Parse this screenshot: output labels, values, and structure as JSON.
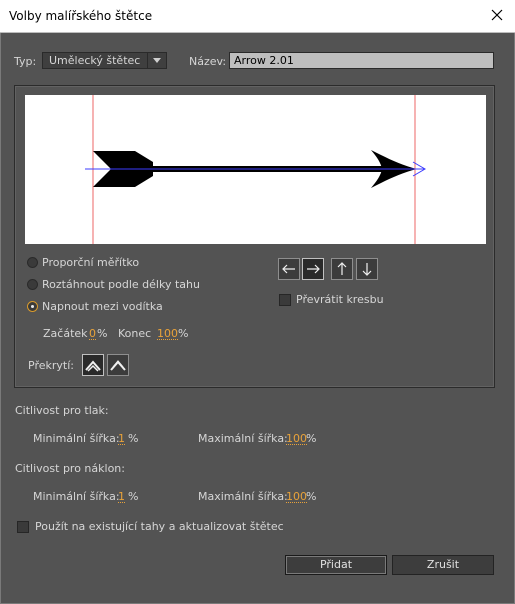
{
  "window": {
    "title": "Volby malířského štětce"
  },
  "type_field": {
    "label": "Typ:",
    "value": "Umělecký štětec"
  },
  "name_field": {
    "label": "Název:",
    "value": "Arrow 2.01"
  },
  "scale_options": [
    {
      "label": "Proporční měřítko",
      "checked": false
    },
    {
      "label": "Roztáhnout podle délky tahu",
      "checked": false
    },
    {
      "label": "Napnout mezi vodítka",
      "checked": true
    }
  ],
  "guides": {
    "start_label": "Začátek",
    "start_value": "0",
    "start_unit": "%",
    "end_label": "Konec",
    "end_value": "100",
    "end_unit": "%"
  },
  "direction": {
    "buttons": [
      "left-arrow-icon",
      "right-arrow-icon",
      "up-arrow-icon",
      "down-arrow-icon"
    ],
    "active": "right"
  },
  "flip": {
    "label": "Převrátit kresbu",
    "checked": false
  },
  "overlap": {
    "label": "Překrytí:"
  },
  "pressure": {
    "heading": "Citlivost pro tlak:",
    "min_label": "Minimální šířka:",
    "min_value": "1",
    "min_unit": "%",
    "max_label": "Maximální šířka:",
    "max_value": "100",
    "max_unit": "%"
  },
  "tilt": {
    "heading": "Citlivost pro náklon:",
    "min_label": "Minimální šířka:",
    "min_value": "1",
    "min_unit": "%",
    "max_label": "Maximální šířka:",
    "max_value": "100",
    "max_unit": "%"
  },
  "apply_existing": {
    "label": "Použít na existující tahy a aktualizovat štětec",
    "checked": false
  },
  "buttons": {
    "add": "Přidat",
    "cancel": "Zrušit"
  },
  "colors": {
    "dialog_bg": "#535353",
    "accent": "#e8a23a",
    "guide": "#f08080",
    "path": "#3b3bff"
  }
}
